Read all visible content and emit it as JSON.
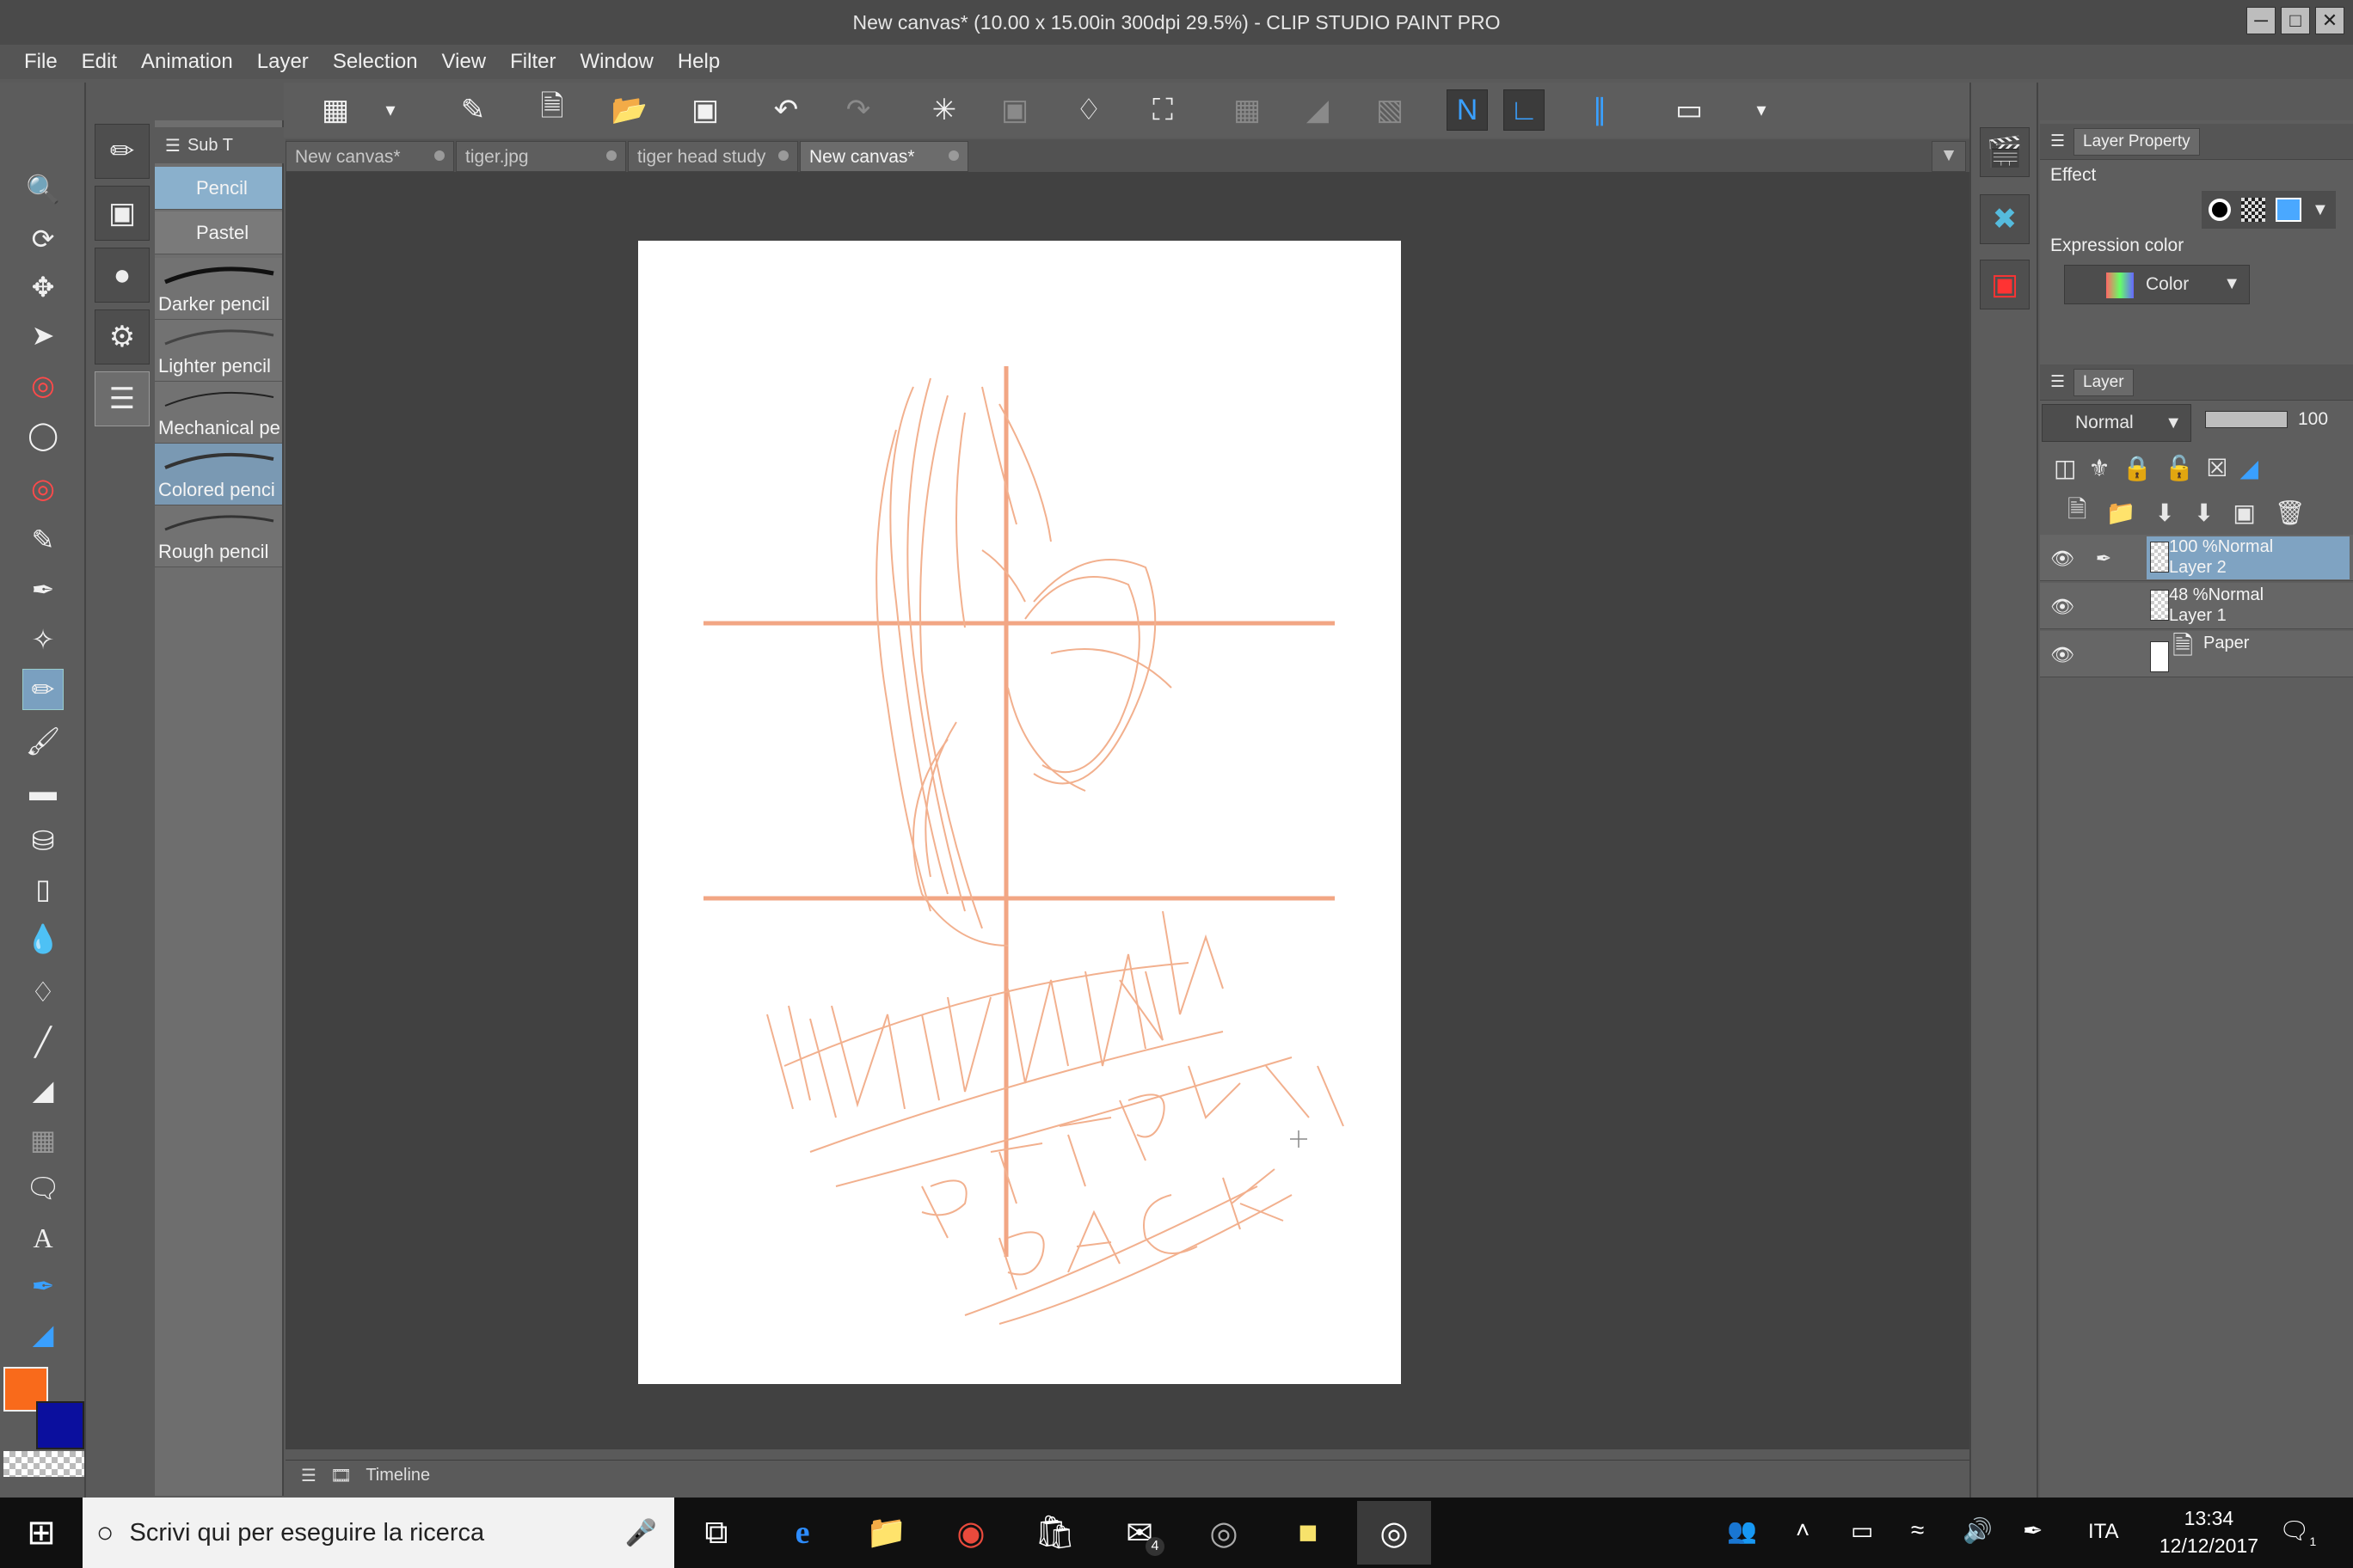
{
  "window": {
    "title": "New canvas* (10.00 x 15.00in 300dpi 29.5%)  - CLIP STUDIO PAINT PRO",
    "controls": [
      "─",
      "□",
      "✕"
    ]
  },
  "menu": [
    "File",
    "Edit",
    "Animation",
    "Layer",
    "Selection",
    "View",
    "Filter",
    "Window",
    "Help"
  ],
  "subtool_panel": {
    "header": "Sub T",
    "items": [
      {
        "label": "Pencil",
        "selected": true,
        "kind": "row"
      },
      {
        "label": "Pastel",
        "selected": false,
        "kind": "row"
      },
      {
        "label": "Darker pencil",
        "selected": false,
        "kind": "thumb"
      },
      {
        "label": "Lighter pencil",
        "selected": false,
        "kind": "thumb"
      },
      {
        "label": "Mechanical pe",
        "selected": false,
        "kind": "thumb"
      },
      {
        "label": "Colored penci",
        "selected": true,
        "kind": "thumb"
      },
      {
        "label": "Rough pencil",
        "selected": false,
        "kind": "thumb"
      }
    ]
  },
  "tabs": [
    {
      "label": "New canvas*",
      "active": false
    },
    {
      "label": "tiger.jpg",
      "active": false
    },
    {
      "label": "tiger head study",
      "active": false
    },
    {
      "label": "New canvas*",
      "active": true
    }
  ],
  "colors": {
    "main": "#f96a1b",
    "sub": "#0b0f9e",
    "sketch": "#f2b08e",
    "guide": "#f2a684"
  },
  "timeline": {
    "label": "Timeline"
  },
  "layer_property": {
    "tab": "Layer Property",
    "effect_label": "Effect",
    "expression_label": "Expression color",
    "expression_value": "Color"
  },
  "layer_panel": {
    "tab": "Layer",
    "blend_mode": "Normal",
    "opacity": "100",
    "layers": [
      {
        "line1": "100 %Normal",
        "line2": "Layer 2",
        "selected": true
      },
      {
        "line1": "48 %Normal",
        "line2": "Layer 1",
        "selected": false
      },
      {
        "line1": "",
        "line2": "Paper",
        "selected": false
      }
    ]
  },
  "taskbar": {
    "search_placeholder": "Scrivi qui per eseguire la ricerca",
    "language": "ITA",
    "time": "13:34",
    "date": "12/12/2017",
    "mail_badge": "4",
    "notif_badge": "1"
  }
}
